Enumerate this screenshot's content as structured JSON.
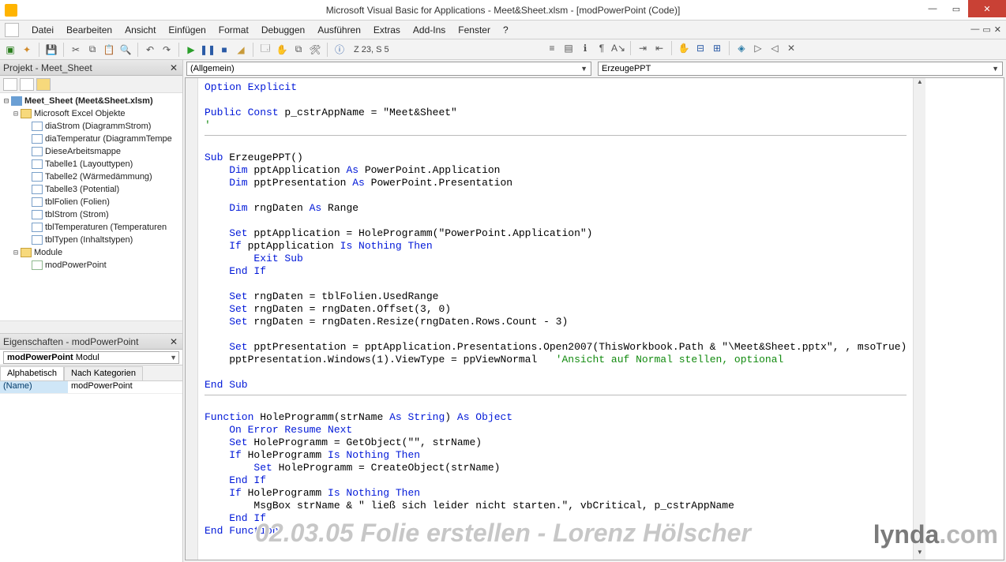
{
  "title": "Microsoft Visual Basic for Applications - Meet&Sheet.xlsm - [modPowerPoint (Code)]",
  "menu": [
    "Datei",
    "Bearbeiten",
    "Ansicht",
    "Einfügen",
    "Format",
    "Debuggen",
    "Ausführen",
    "Extras",
    "Add-Ins",
    "Fenster",
    "?"
  ],
  "status_pos": "Z 23, S 5",
  "project_panel": {
    "title": "Projekt - Meet_Sheet",
    "root": "Meet_Sheet (Meet&Sheet.xlsm)",
    "excel_group": "Microsoft Excel Objekte",
    "excel_items": [
      "diaStrom (DiagrammStrom)",
      "diaTemperatur (DiagrammTempe",
      "DieseArbeitsmappe",
      "Tabelle1 (Layouttypen)",
      "Tabelle2 (Wärmedämmung)",
      "Tabelle3 (Potential)",
      "tblFolien (Folien)",
      "tblStrom (Strom)",
      "tblTemperaturen (Temperaturen",
      "tblTypen (Inhaltstypen)"
    ],
    "module_group": "Module",
    "module_items": [
      "modPowerPoint"
    ]
  },
  "props_panel": {
    "title": "Eigenschaften - modPowerPoint",
    "selector_name": "modPowerPoint",
    "selector_type": "Modul",
    "tab1": "Alphabetisch",
    "tab2": "Nach Kategorien",
    "row_name": "(Name)",
    "row_val": "modPowerPoint"
  },
  "code_dropdowns": {
    "left": "(Allgemein)",
    "right": "ErzeugePPT"
  },
  "code": {
    "l1_a": "Option Explicit",
    "l2_a": "Public Const",
    "l2_b": " p_cstrAppName = \"Meet&Sheet\"",
    "l3_a": "'",
    "l4_a": "Sub",
    "l4_b": " ErzeugePPT()",
    "l5_a": "    Dim",
    "l5_b": " pptApplication ",
    "l5_c": "As",
    "l5_d": " PowerPoint.Application",
    "l6_a": "    Dim",
    "l6_b": " pptPresentation ",
    "l6_c": "As",
    "l6_d": " PowerPoint.Presentation",
    "l7_a": "    Dim",
    "l7_b": " rngDaten ",
    "l7_c": "As",
    "l7_d": " Range",
    "l8_a": "    Set",
    "l8_b": " pptApplication = HoleProgramm(\"PowerPoint.Application\")",
    "l9_a": "    If",
    "l9_b": " pptApplication ",
    "l9_c": "Is Nothing Then",
    "l10_a": "        Exit Sub",
    "l11_a": "    End If",
    "l12_a": "    Set",
    "l12_b": " rngDaten = tblFolien.UsedRange",
    "l13_a": "    Set",
    "l13_b": " rngDaten = rngDaten.Offset(3, 0)",
    "l14_a": "    Set",
    "l14_b": " rngDaten = rngDaten.Resize(rngDaten.Rows.Count - 3)",
    "l15_a": "    Set",
    "l15_b": " pptPresentation = pptApplication.Presentations.Open2007(ThisWorkbook.Path & \"\\Meet&Sheet.pptx\", , msoTrue)",
    "l16_a": "    pptPresentation.Windows(1).ViewType = ppViewNormal   ",
    "l16_b": "'Ansicht auf Normal stellen, optional",
    "l17_a": "End Sub",
    "l18_a": "Function",
    "l18_b": " HoleProgramm(strName ",
    "l18_c": "As String",
    "l18_d": ") ",
    "l18_e": "As Object",
    "l19_a": "    On Error Resume Next",
    "l20_a": "    Set",
    "l20_b": " HoleProgramm = GetObject(\"\", strName)",
    "l21_a": "    If",
    "l21_b": " HoleProgramm ",
    "l21_c": "Is Nothing Then",
    "l22_a": "        Set",
    "l22_b": " HoleProgramm = CreateObject(strName)",
    "l23_a": "    End If",
    "l24_a": "    If",
    "l24_b": " HoleProgramm ",
    "l24_c": "Is Nothing Then",
    "l25_a": "        MsgBox strName & \" ließ sich leider nicht starten.\", vbCritical, p_cstrAppName",
    "l26_a": "    End If",
    "l27_a": "End Function"
  },
  "watermark": "02.03.05 Folie erstellen - Lorenz Hölscher",
  "brand": {
    "a": "lynda",
    "b": ".com"
  }
}
